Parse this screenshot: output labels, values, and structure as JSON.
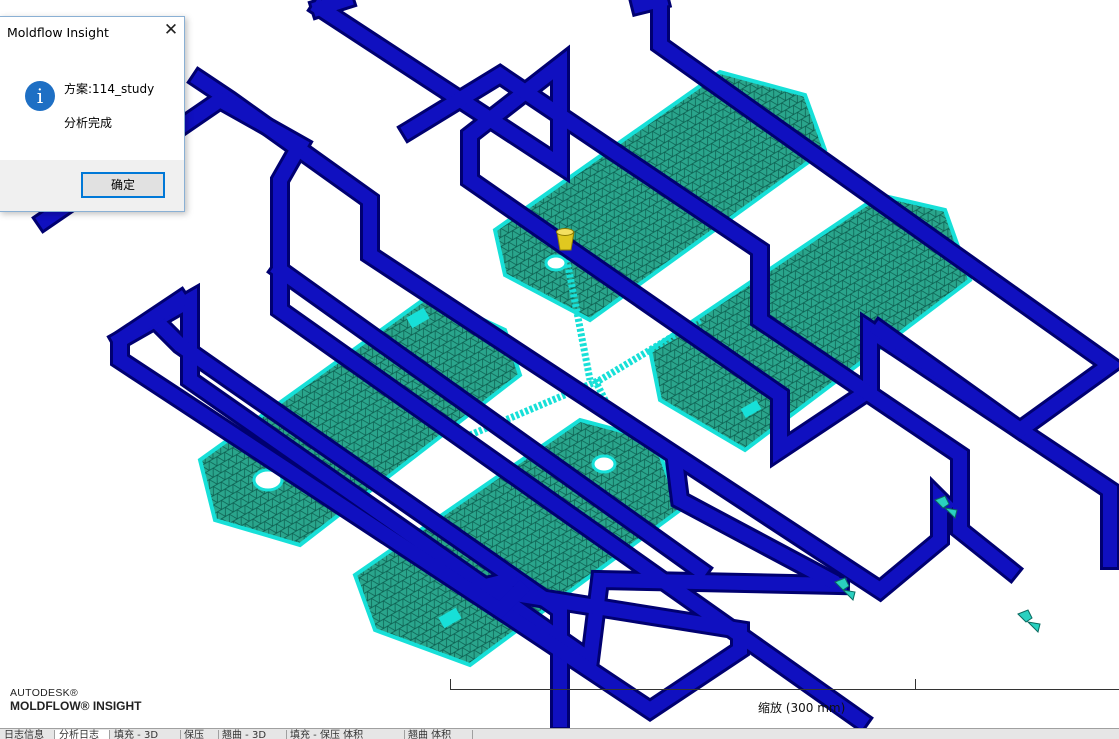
{
  "dialog": {
    "title": "Moldflow Insight",
    "close_glyph": "✕",
    "icon": "info-icon",
    "icon_glyph": "i",
    "message_study": "方案:114_study",
    "message_status": "分析完成",
    "ok_label": "确定"
  },
  "logo": {
    "line1": "AUTODESK®",
    "line2": "MOLDFLOW® INSIGHT"
  },
  "scale": {
    "label": "缩放 (300 mm)"
  },
  "tabs": [
    {
      "label": "日志信息"
    },
    {
      "label": "分析日志"
    },
    {
      "label": "填充 - 3D"
    },
    {
      "label": "保压"
    },
    {
      "label": "翘曲 - 3D"
    },
    {
      "label": "填充 - 保压 体积"
    },
    {
      "label": "翘曲 体积"
    }
  ],
  "colors": {
    "cooling_channel": "#1010c0",
    "cooling_channel_edge": "#000070",
    "mesh_fill": "#2aa58c",
    "mesh_edge": "#17e0d8",
    "gate": "#e0c820",
    "dialog_button_border": "#0078d7"
  }
}
